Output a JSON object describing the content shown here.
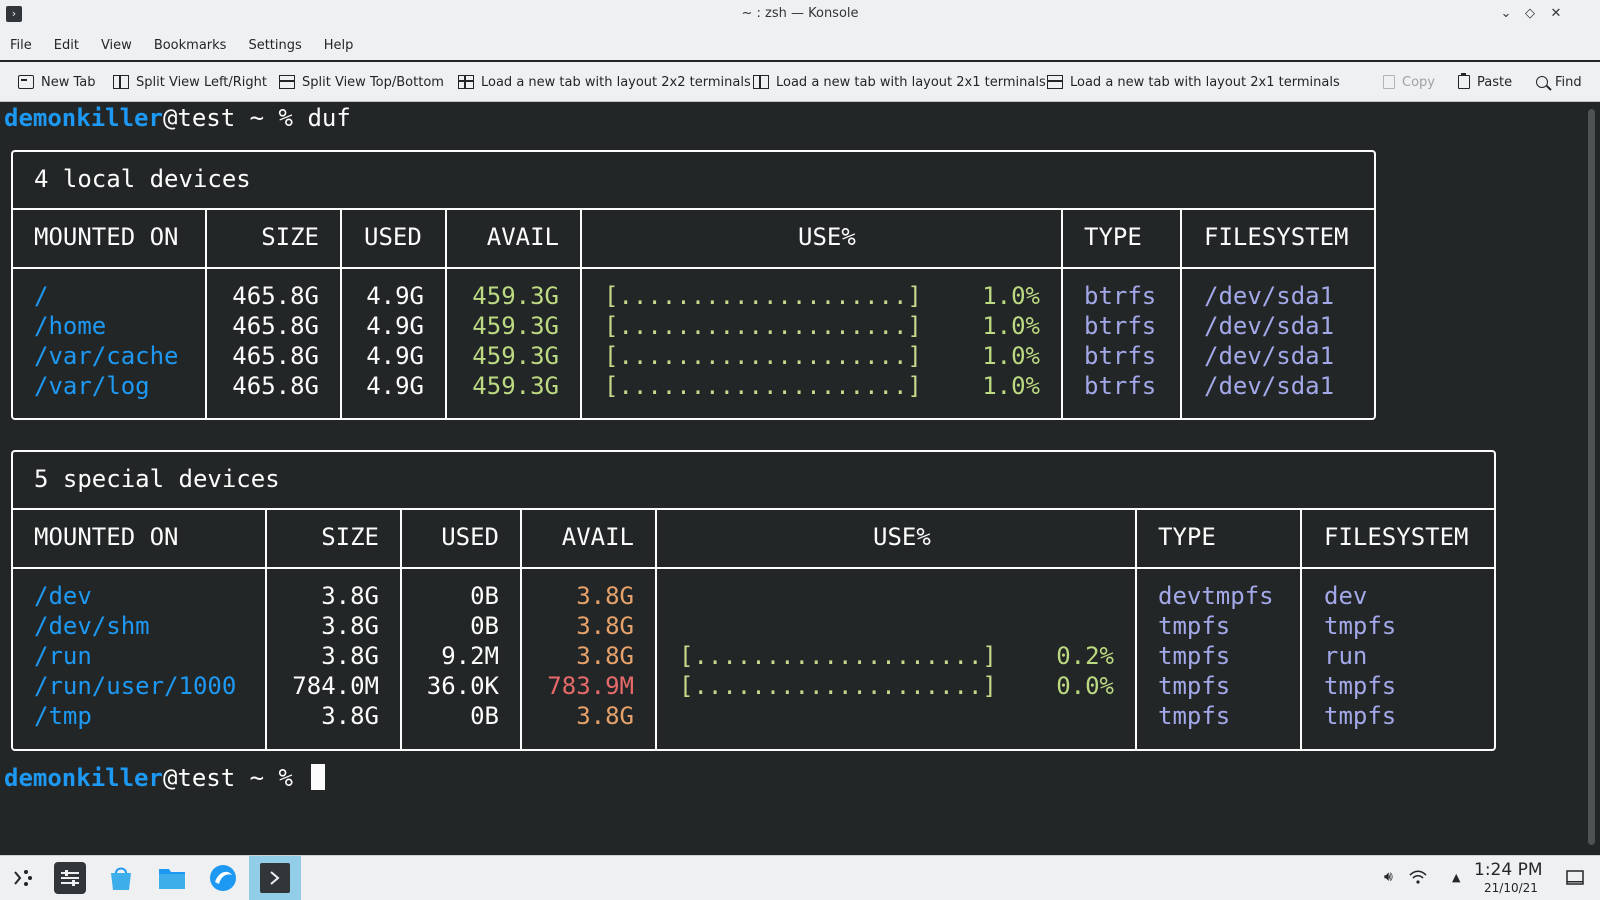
{
  "window": {
    "title": "~ : zsh — Konsole",
    "app_icon": "konsole-icon",
    "controls": [
      "minimize",
      "maximize",
      "close"
    ]
  },
  "menu": [
    "File",
    "Edit",
    "View",
    "Bookmarks",
    "Settings",
    "Help"
  ],
  "toolbar": {
    "new_tab": "New Tab",
    "split_lr": "Split View Left/Right",
    "split_tb": "Split View Top/Bottom",
    "layout_2x2": "Load a new tab with layout 2x2 terminals",
    "layout_2x1_a": "Load a new tab with layout 2x1 terminals",
    "layout_2x1_b": "Load a new tab with layout 2x1 terminals",
    "copy": "Copy",
    "paste": "Paste",
    "find": "Find"
  },
  "prompt": {
    "user": "demonkiller",
    "host_suffix": "@test ~ % ",
    "command": "duf"
  },
  "local": {
    "title": "4 local devices",
    "headers": [
      "MOUNTED ON",
      "SIZE",
      "USED",
      "AVAIL",
      "USE%",
      "TYPE",
      "FILESYSTEM"
    ],
    "rows": [
      {
        "mount": "/",
        "size": "465.8G",
        "used": "4.9G",
        "avail": "459.3G",
        "bar": "[....................]",
        "pct": "1.0%",
        "type": "btrfs",
        "fs": "/dev/sda1"
      },
      {
        "mount": "/home",
        "size": "465.8G",
        "used": "4.9G",
        "avail": "459.3G",
        "bar": "[....................]",
        "pct": "1.0%",
        "type": "btrfs",
        "fs": "/dev/sda1"
      },
      {
        "mount": "/var/cache",
        "size": "465.8G",
        "used": "4.9G",
        "avail": "459.3G",
        "bar": "[....................]",
        "pct": "1.0%",
        "type": "btrfs",
        "fs": "/dev/sda1"
      },
      {
        "mount": "/var/log",
        "size": "465.8G",
        "used": "4.9G",
        "avail": "459.3G",
        "bar": "[....................]",
        "pct": "1.0%",
        "type": "btrfs",
        "fs": "/dev/sda1"
      }
    ]
  },
  "special": {
    "title": "5 special devices",
    "headers": [
      "MOUNTED ON",
      "SIZE",
      "USED",
      "AVAIL",
      "USE%",
      "TYPE",
      "FILESYSTEM"
    ],
    "rows": [
      {
        "mount": "/dev",
        "size": "3.8G",
        "used": "0B",
        "avail": "3.8G",
        "bar": "",
        "pct": "",
        "type": "devtmpfs",
        "fs": "dev"
      },
      {
        "mount": "/dev/shm",
        "size": "3.8G",
        "used": "0B",
        "avail": "3.8G",
        "bar": "",
        "pct": "",
        "type": "tmpfs",
        "fs": "tmpfs"
      },
      {
        "mount": "/run",
        "size": "3.8G",
        "used": "9.2M",
        "avail": "3.8G",
        "bar": "[....................]",
        "pct": "0.2%",
        "type": "tmpfs",
        "fs": "run"
      },
      {
        "mount": "/run/user/1000",
        "size": "784.0M",
        "used": "36.0K",
        "avail": "783.9M",
        "bar": "[....................]",
        "pct": "0.0%",
        "type": "tmpfs",
        "fs": "tmpfs"
      },
      {
        "mount": "/tmp",
        "size": "3.8G",
        "used": "0B",
        "avail": "3.8G",
        "bar": "",
        "pct": "",
        "type": "tmpfs",
        "fs": "tmpfs"
      }
    ]
  },
  "prompt2": {
    "user": "demonkiller",
    "host_suffix": "@test ~ % "
  },
  "taskbar": {
    "apps": [
      "application-launcher-icon",
      "settings-panel-icon",
      "discover-store-icon",
      "file-manager-icon",
      "browser-icon",
      "konsole-icon"
    ],
    "tray": [
      "volume-icon",
      "wifi-icon",
      "tray-expand-icon"
    ],
    "time": "1:24 PM",
    "date": "21/10/21",
    "show_desktop": "show-desktop-icon"
  },
  "colors": {
    "bg": "#232627",
    "mount": "#1d99f3",
    "avail_ok": "#bbda82",
    "avail_warn": "#e6a26a",
    "avail_bad": "#e76a6a",
    "fs": "#a2a8e8"
  }
}
